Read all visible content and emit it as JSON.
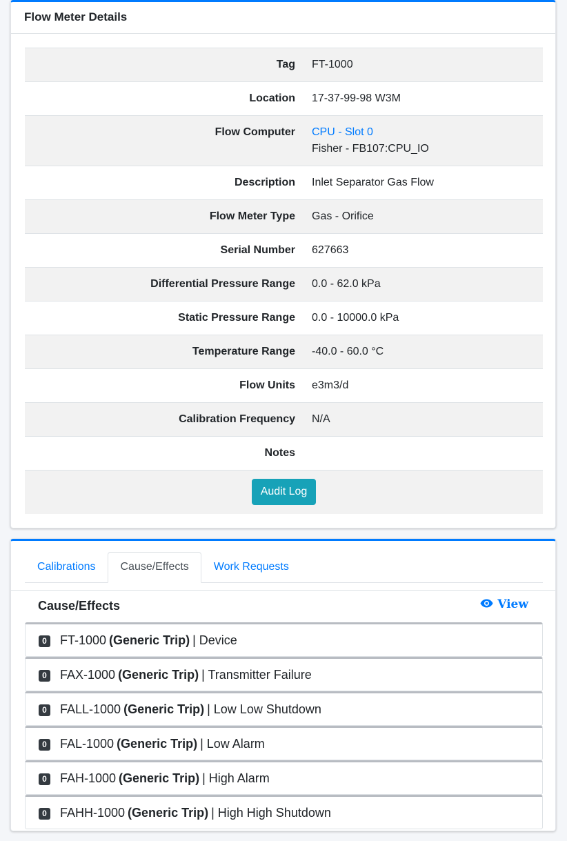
{
  "details_card": {
    "title": "Flow Meter Details",
    "rows": [
      {
        "label": "Tag",
        "value": "FT-1000"
      },
      {
        "label": "Location",
        "value": "17-37-99-98 W3M"
      },
      {
        "label": "Flow Computer",
        "link": "CPU - Slot 0",
        "value": "Fisher - FB107:CPU_IO"
      },
      {
        "label": "Description",
        "value": "Inlet Separator Gas Flow"
      },
      {
        "label": "Flow Meter Type",
        "value": "Gas - Orifice"
      },
      {
        "label": "Serial Number",
        "value": "627663"
      },
      {
        "label": "Differential Pressure Range",
        "value": "0.0 - 62.0 kPa"
      },
      {
        "label": "Static Pressure Range",
        "value": "0.0 - 10000.0 kPa"
      },
      {
        "label": "Temperature Range",
        "value": "-40.0 - 60.0 °C"
      },
      {
        "label": "Flow Units",
        "value": "e3m3/d"
      },
      {
        "label": "Calibration Frequency",
        "value": "N/A"
      },
      {
        "label": "Notes",
        "value": ""
      }
    ],
    "audit_button": "Audit Log"
  },
  "tabs": [
    {
      "label": "Calibrations",
      "active": false
    },
    {
      "label": "Cause/Effects",
      "active": true
    },
    {
      "label": "Work Requests",
      "active": false
    }
  ],
  "cause_effects": {
    "title": "Cause/Effects",
    "view_label": "View",
    "items": [
      {
        "count": "0",
        "tag": "FT-1000",
        "kind": "(Generic Trip)",
        "desc": "| Device"
      },
      {
        "count": "0",
        "tag": "FAX-1000",
        "kind": "(Generic Trip)",
        "desc": "| Transmitter Failure"
      },
      {
        "count": "0",
        "tag": "FALL-1000",
        "kind": "(Generic Trip)",
        "desc": "| Low Low Shutdown"
      },
      {
        "count": "0",
        "tag": "FAL-1000",
        "kind": "(Generic Trip)",
        "desc": "| Low Alarm"
      },
      {
        "count": "0",
        "tag": "FAH-1000",
        "kind": "(Generic Trip)",
        "desc": "| High Alarm"
      },
      {
        "count": "0",
        "tag": "FAHH-1000",
        "kind": "(Generic Trip)",
        "desc": "| High High Shutdown"
      }
    ]
  },
  "colors": {
    "primary": "#007bff",
    "info": "#17a2b8",
    "badge": "#343a40"
  }
}
